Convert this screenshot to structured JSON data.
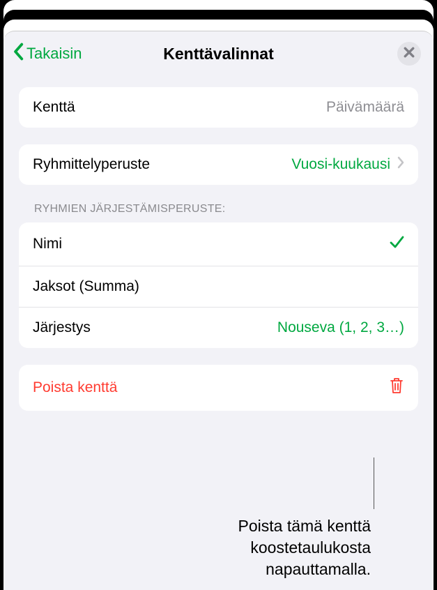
{
  "nav": {
    "back_label": "Takaisin",
    "title": "Kenttävalinnat"
  },
  "field_row": {
    "label": "Kenttä",
    "value": "Päivämäärä"
  },
  "group_by_row": {
    "label": "Ryhmittelyperuste",
    "value": "Vuosi-kuukausi"
  },
  "sort_section_header": "RYHMIEN JÄRJESTÄMISPERUSTE:",
  "sort_options": {
    "name": "Nimi",
    "periods": "Jaksot  (Summa)",
    "order_label": "Järjestys",
    "order_value": "Nouseva (1, 2, 3…)"
  },
  "delete_row": {
    "label": "Poista kenttä"
  },
  "callout": {
    "line1": "Poista tämä kenttä",
    "line2": "koostetaulukosta",
    "line3": "napauttamalla."
  }
}
